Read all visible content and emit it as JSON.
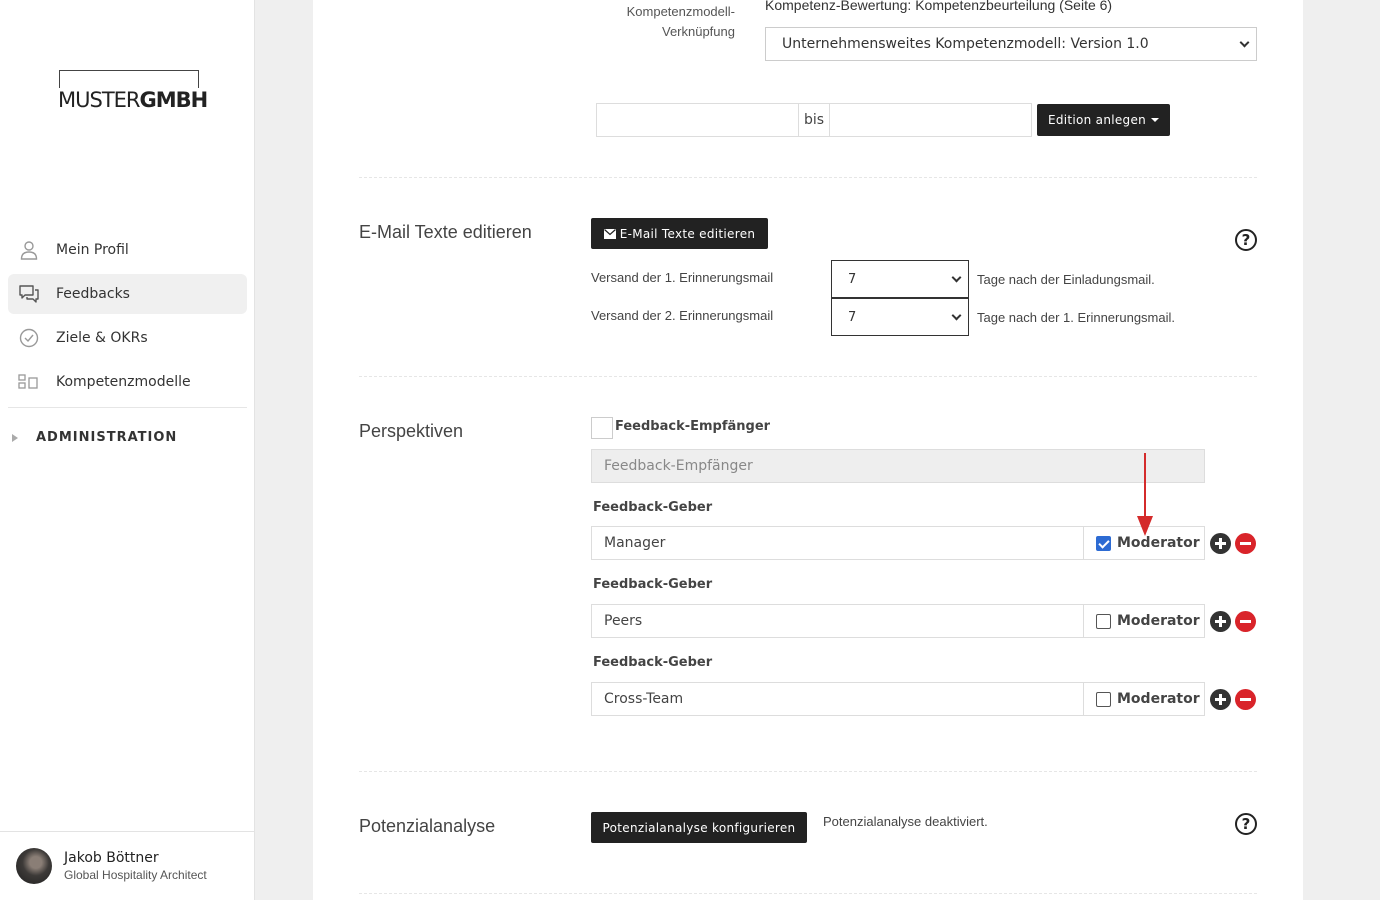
{
  "sidebar": {
    "logo": {
      "part1": "MUSTER",
      "part2": "GMBH"
    },
    "items": [
      {
        "label": "Mein Profil",
        "icon": "user-icon"
      },
      {
        "label": "Feedbacks",
        "icon": "chat-icon"
      },
      {
        "label": "Ziele & OKRs",
        "icon": "check-circle-icon"
      },
      {
        "label": "Kompetenzmodelle",
        "icon": "grid-icon"
      }
    ],
    "admin_label": "ADMINISTRATION",
    "user": {
      "name": "Jakob Böttner",
      "role": "Global Hospitality Architect"
    }
  },
  "competence": {
    "label_line1": "Kompetenzmodell-",
    "label_line2": "Verknüpfung",
    "heading": "Kompetenz-Bewertung: Kompetenzbeurteilung (Seite 6)",
    "selected": "Unternehmensweites Kompetenzmodell: Version 1.0"
  },
  "edition": {
    "from_value": "",
    "bis_label": "bis",
    "to_value": "",
    "button_label": "Edition anlegen"
  },
  "email": {
    "title": "E-Mail Texte editieren",
    "button_label": "E-Mail Texte editieren",
    "reminder1": {
      "label": "Versand der 1. Erinnerungsmail",
      "value": "7",
      "suffix": "Tage nach der Einladungsmail."
    },
    "reminder2": {
      "label": "Versand der 2. Erinnerungsmail",
      "value": "7",
      "suffix": "Tage nach der 1. Erinnerungsmail."
    },
    "help": "?"
  },
  "perspectives": {
    "title": "Perspektiven",
    "recipient_checkbox_label": "Feedback-Empfänger",
    "recipient_placeholder": "Feedback-Empfänger",
    "givers": [
      {
        "label": "Feedback-Geber",
        "value": "Manager",
        "moderator_label": "Moderator",
        "moderator": true
      },
      {
        "label": "Feedback-Geber",
        "value": "Peers",
        "moderator_label": "Moderator",
        "moderator": false
      },
      {
        "label": "Feedback-Geber",
        "value": "Cross-Team",
        "moderator_label": "Moderator",
        "moderator": false
      }
    ]
  },
  "potential": {
    "title": "Potenzialanalyse",
    "button_label": "Potenzialanalyse konfigurieren",
    "status": "Potenzialanalyse deaktiviert.",
    "help": "?"
  },
  "colors": {
    "accent": "#2d6bd3",
    "danger": "#d9242a",
    "arrow": "#d42b2b",
    "dark": "#222222"
  }
}
